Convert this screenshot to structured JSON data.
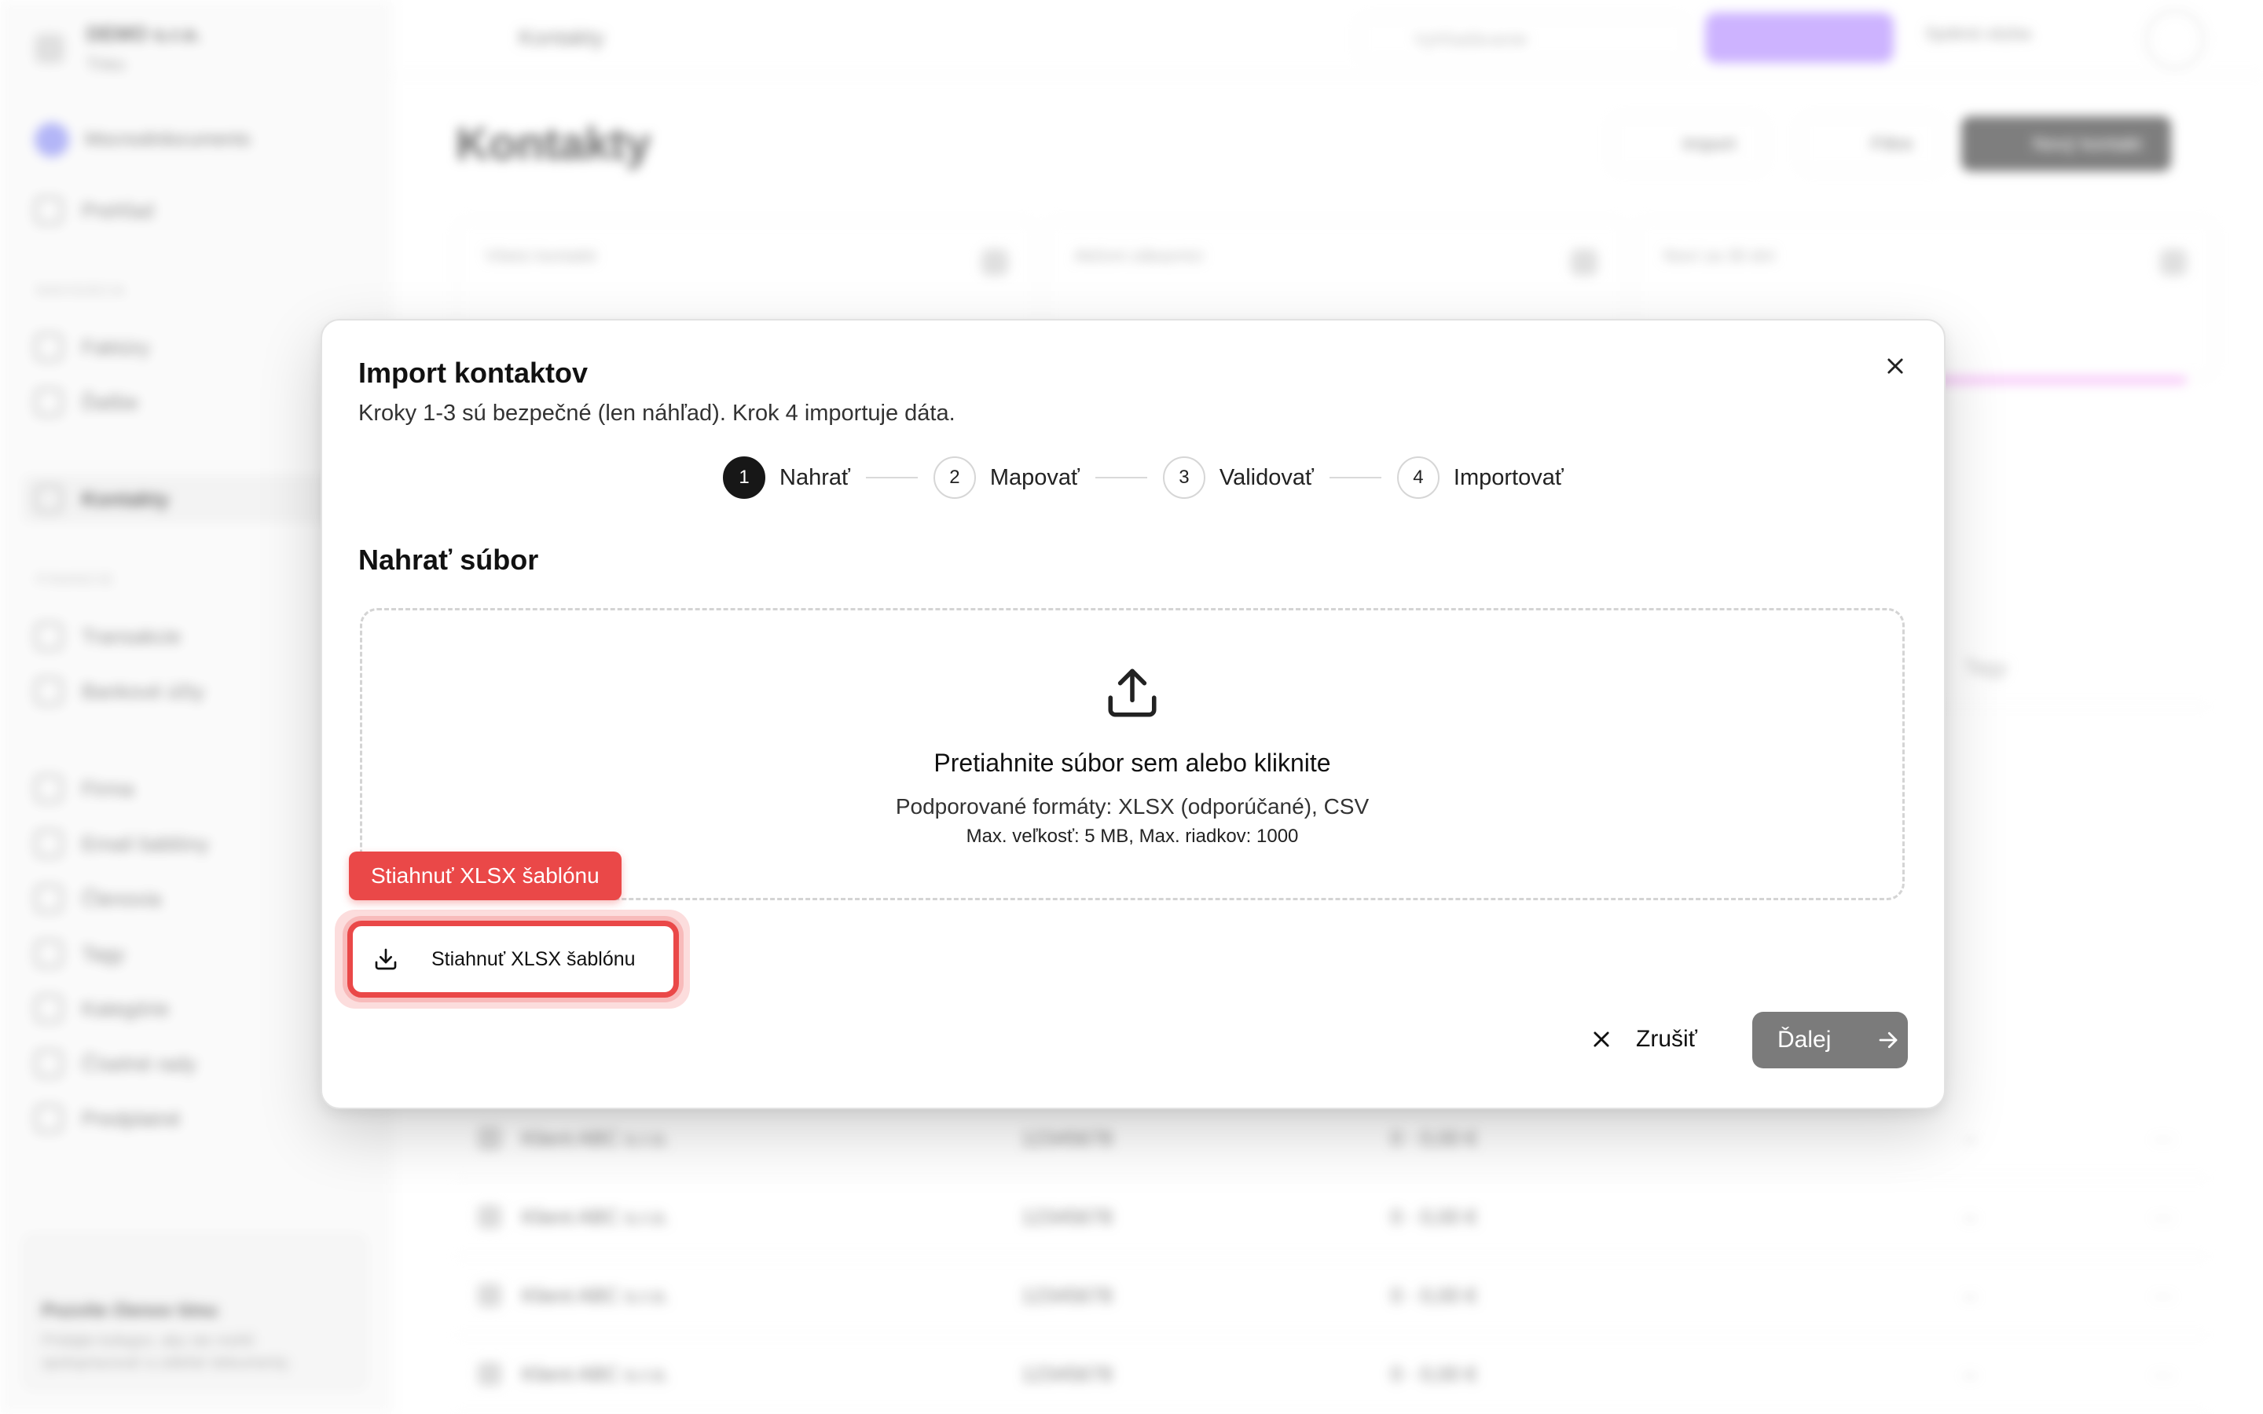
{
  "background": {
    "org": {
      "name": "DEMO s.r.o.",
      "subtitle": "Trieu"
    },
    "workspace": "Mocnodrdocuments",
    "sidebar": {
      "sections": [
        "NAVIGÁCIA",
        "FINANCIE"
      ],
      "items": [
        {
          "label": "Prehľad"
        },
        {
          "label": "Faktúry"
        },
        {
          "label": "Ďalšie"
        },
        {
          "label": "Kontakty"
        },
        {
          "label": "Transakcie"
        },
        {
          "label": "Bankové účty"
        },
        {
          "label": "Firma"
        },
        {
          "label": "Email šablóny"
        },
        {
          "label": "Členovia"
        },
        {
          "label": "Tagy"
        },
        {
          "label": "Kategórie"
        },
        {
          "label": "Číselné rady"
        },
        {
          "label": "Predplatné"
        }
      ],
      "promo": {
        "title": "Pozvite členov tímu",
        "text": "Pridajte kolegov, aby ste mohli spolupracovať a zdieľať dokumenty."
      }
    },
    "topbar": {
      "title": "Kontakty",
      "search_placeholder": "Vyhľadávanie",
      "help": "Spätná väzba"
    },
    "page_title": "Kontakty",
    "actions": {
      "import": "Import",
      "filter": "Filtre",
      "new": "Nový kontakt"
    },
    "stats": [
      {
        "label": "Všetci kontakti"
      },
      {
        "label": "Aktívni zákazníci"
      },
      {
        "label": "Noví za 30 dní"
      }
    ],
    "table": {
      "column_tags": "Tagy",
      "rows": [
        {
          "name": "Klient ABC s.r.o.",
          "ico": "12345678",
          "amount": "0 · 0,00 €",
          "tags": "–",
          "more": "···"
        },
        {
          "name": "Klient ABC s.r.o.",
          "ico": "12345678",
          "amount": "0 · 0,00 €",
          "tags": "–",
          "more": "···"
        },
        {
          "name": "Klient ABC s.r.o.",
          "ico": "12345678",
          "amount": "0 · 0,00 €",
          "tags": "–",
          "more": "···"
        },
        {
          "name": "Klient ABC s.r.o.",
          "ico": "12345678",
          "amount": "0 · 0,00 €",
          "tags": "–",
          "more": "···"
        },
        {
          "name": "Klient ABC s.r.o.",
          "ico": "12345678",
          "amount": "0 · 0,00 €",
          "tags": "–",
          "more": "···"
        }
      ]
    }
  },
  "modal": {
    "title": "Import kontaktov",
    "subtitle": "Kroky 1-3 sú bezpečné (len náhľad). Krok 4 importuje dáta.",
    "steps": [
      {
        "number": "1",
        "label": "Nahrať",
        "active": true
      },
      {
        "number": "2",
        "label": "Mapovať",
        "active": false
      },
      {
        "number": "3",
        "label": "Validovať",
        "active": false
      },
      {
        "number": "4",
        "label": "Importovať",
        "active": false
      }
    ],
    "section_title": "Nahrať súbor",
    "dropzone": {
      "icon": "upload-icon",
      "main_text": "Pretiahnite súbor sem alebo kliknite",
      "formats": "Podporované formáty: XLSX (odporúčané), CSV",
      "limits": "Max. veľkosť: 5 MB, Max. riadkov: 1000"
    },
    "tooltip": "Stiahnuť XLSX šablónu",
    "template_button": {
      "label": "Stiahnuť XLSX šablónu",
      "icon": "download-icon"
    },
    "cancel_label": "Zrušiť",
    "next_label": "Ďalej"
  },
  "colors": {
    "highlight": "#ea4848",
    "primary_dark": "#171717",
    "next_button": "#7b7b7b"
  }
}
